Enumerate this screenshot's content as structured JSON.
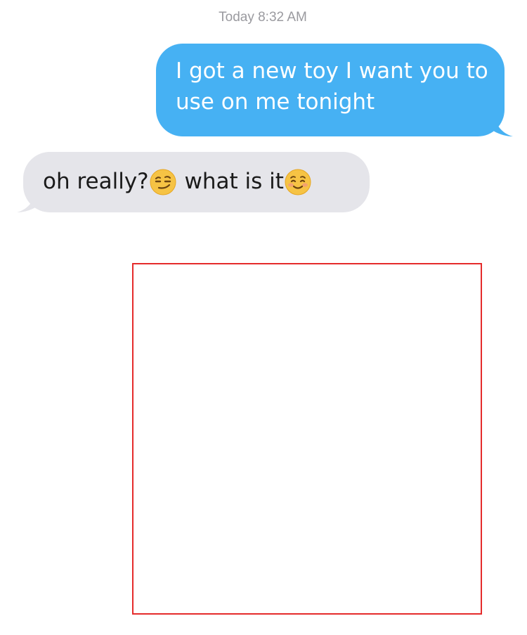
{
  "conversation": {
    "timestamp": "Today 8:32 AM",
    "messages": [
      {
        "direction": "outgoing",
        "text": "I got a new toy I want you to use on me tonight"
      },
      {
        "direction": "incoming",
        "parts": [
          "oh really?",
          " what is it"
        ],
        "emojis": [
          "smirking-face",
          "smiling-face"
        ]
      }
    ]
  },
  "colors": {
    "outgoing_bubble": "#46b1f3",
    "incoming_bubble": "#e5e5ea",
    "timestamp_text": "#9a9a9f",
    "frame_border": "#e52b2b"
  }
}
